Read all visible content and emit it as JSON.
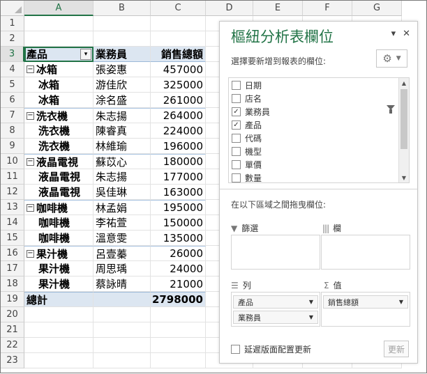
{
  "columns": [
    "A",
    "B",
    "C",
    "D",
    "E",
    "F",
    "G"
  ],
  "rows": [
    "1",
    "2",
    "3",
    "4",
    "5",
    "6",
    "7",
    "8",
    "9",
    "10",
    "11",
    "12",
    "13",
    "14",
    "15",
    "16",
    "17",
    "18",
    "19",
    "20",
    "21",
    "22",
    "23"
  ],
  "pivot": {
    "header": {
      "product": "產品",
      "salesperson": "業務員",
      "total_sales": "銷售總額"
    },
    "groups": [
      {
        "product": "冰箱",
        "items": [
          {
            "product": "冰箱",
            "person": "張姿惠",
            "amount": "457000"
          },
          {
            "product": "冰箱",
            "person": "游佳欣",
            "amount": "325000"
          },
          {
            "product": "冰箱",
            "person": "涂名盛",
            "amount": "261000"
          }
        ]
      },
      {
        "product": "洗衣機",
        "items": [
          {
            "product": "洗衣機",
            "person": "朱志揚",
            "amount": "264000"
          },
          {
            "product": "洗衣機",
            "person": "陳睿真",
            "amount": "224000"
          },
          {
            "product": "洗衣機",
            "person": "林維瑜",
            "amount": "196000"
          }
        ]
      },
      {
        "product": "液晶電視",
        "items": [
          {
            "product": "液晶電視",
            "person": "蘇苡心",
            "amount": "180000"
          },
          {
            "product": "液晶電視",
            "person": "朱志揚",
            "amount": "177000"
          },
          {
            "product": "液晶電視",
            "person": "吳佳琳",
            "amount": "163000"
          }
        ]
      },
      {
        "product": "咖啡機",
        "items": [
          {
            "product": "咖啡機",
            "person": "林孟娟",
            "amount": "195000"
          },
          {
            "product": "咖啡機",
            "person": "李祐萱",
            "amount": "150000"
          },
          {
            "product": "咖啡機",
            "person": "溫意雯",
            "amount": "135000"
          }
        ]
      },
      {
        "product": "果汁機",
        "items": [
          {
            "product": "果汁機",
            "person": "呂壹蓁",
            "amount": "26000"
          },
          {
            "product": "果汁機",
            "person": "周思瑀",
            "amount": "24000"
          },
          {
            "product": "果汁機",
            "person": "蔡詠晴",
            "amount": "21000"
          }
        ]
      }
    ],
    "total_label": "總計",
    "total_value": "2798000"
  },
  "pane": {
    "title": "樞紐分析表欄位",
    "choose_label": "選擇要新增到報表的欄位:",
    "fields": [
      {
        "name": "日期",
        "checked": false
      },
      {
        "name": "店名",
        "checked": false
      },
      {
        "name": "業務員",
        "checked": true
      },
      {
        "name": "產品",
        "checked": true
      },
      {
        "name": "代碼",
        "checked": false
      },
      {
        "name": "機型",
        "checked": false
      },
      {
        "name": "單價",
        "checked": false
      },
      {
        "name": "數量",
        "checked": false
      }
    ],
    "drag_label": "在以下區域之間拖曳欄位:",
    "filters_label": "篩選",
    "columns_label": "欄",
    "rows_label": "列",
    "values_label": "值",
    "row_fields": [
      "產品",
      "業務員"
    ],
    "value_fields": [
      "銷售總額"
    ],
    "defer_label": "延遲版面配置更新",
    "update_label": "更新"
  },
  "icons": {
    "pane_dropdown": "chevron-down-icon",
    "pane_close": "close-icon",
    "gear": "gear-icon",
    "filter": "funnel-icon",
    "columns": "columns-icon",
    "rows": "rows-icon",
    "values": "sigma-icon"
  },
  "colors": {
    "accent": "#217346",
    "pivot_header_bg": "#dce6f1"
  }
}
